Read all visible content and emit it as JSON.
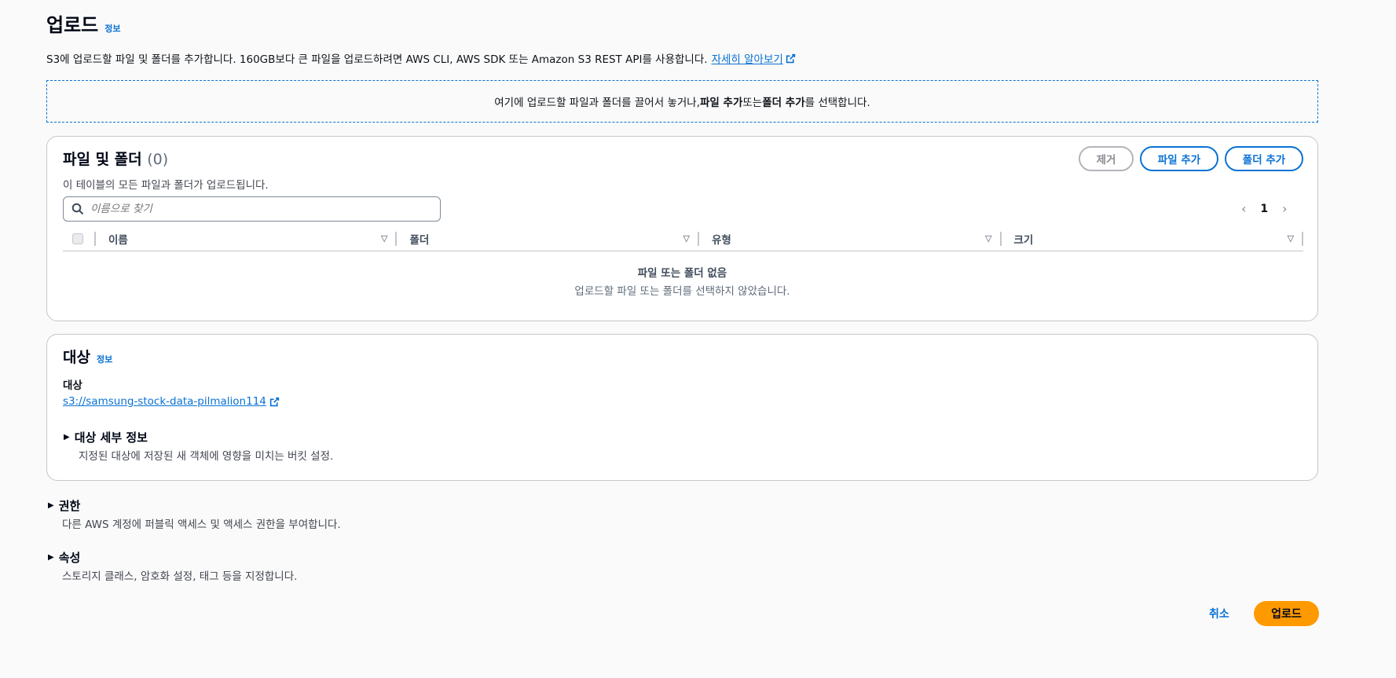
{
  "header": {
    "title": "업로드",
    "info": "정보"
  },
  "description": {
    "text": "S3에 업로드할 파일 및 폴더를 추가합니다. 160GB보다 큰 파일을 업로드하려면 AWS CLI, AWS SDK 또는 Amazon S3 REST API를 사용합니다.",
    "learn_more": "자세히 알아보기"
  },
  "dropzone": {
    "prefix": "여기에 업로드할 파일과 폴더를 끌어서 놓거나, ",
    "add_files": "파일 추가",
    "middle": " 또는 ",
    "add_folder": "폴더 추가",
    "suffix": "를 선택합니다."
  },
  "files": {
    "title": "파일 및 폴더",
    "count": "(0)",
    "subtitle": "이 테이블의 모든 파일과 폴더가 업로드됩니다.",
    "remove": "제거",
    "add_files": "파일 추가",
    "add_folder": "폴더 추가",
    "search_placeholder": "이름으로 찾기",
    "page": "1",
    "columns": [
      "이름",
      "폴더",
      "유형",
      "크기"
    ],
    "empty_title": "파일 또는 폴더 없음",
    "empty_sub": "업로드할 파일 또는 폴더를 선택하지 않았습니다."
  },
  "destination": {
    "title": "대상",
    "info": "정보",
    "label": "대상",
    "link": "s3://samsung-stock-data-pilmalion114",
    "details_title": "대상 세부 정보",
    "details_sub": "지정된 대상에 저장된 새 객체에 영향을 미치는 버킷 설정."
  },
  "permissions": {
    "title": "권한",
    "sub": "다른 AWS 계정에 퍼블릭 액세스 및 액세스 권한을 부여합니다."
  },
  "properties": {
    "title": "속성",
    "sub": "스토리지 클래스, 암호화 설정, 태그 등을 지정합니다."
  },
  "footer": {
    "cancel": "취소",
    "upload": "업로드"
  },
  "colors": {
    "link": "#0972d3",
    "primary": "#ff9900"
  }
}
